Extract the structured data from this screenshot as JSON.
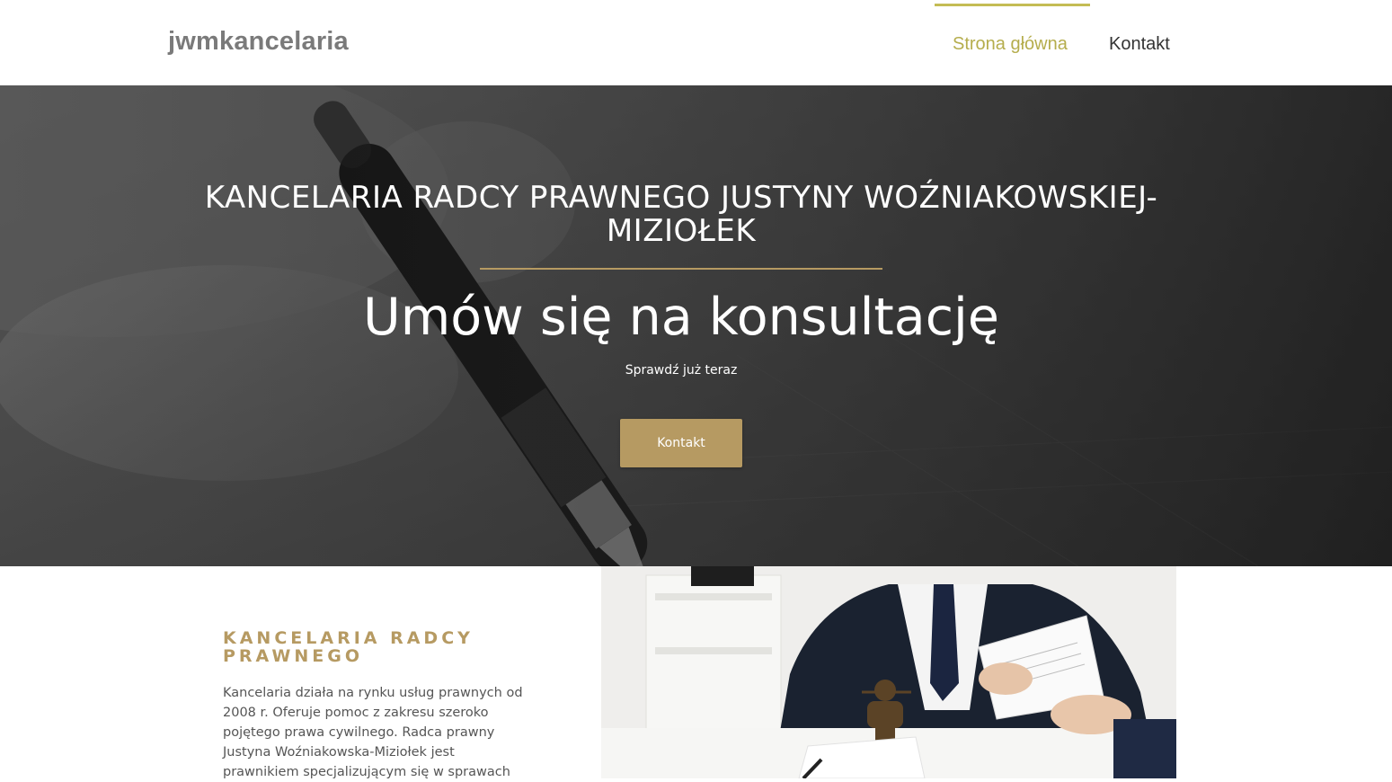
{
  "header": {
    "logo": "jwmkancelaria",
    "nav": [
      {
        "label": "Strona główna",
        "active": true
      },
      {
        "label": "Kontakt",
        "active": false
      }
    ]
  },
  "hero": {
    "title": "KANCELARIA RADCY PRAWNEGO JUSTYNY WOŹNIAKOWSKIEJ-MIZIOŁEK",
    "subtitle": "Umów się na konsultację",
    "tagline": "Sprawdź już teraz",
    "button_label": "Kontakt"
  },
  "about": {
    "heading": "KANCELARIA RADCY PRAWNEGO",
    "text": "Kancelaria działa na rynku usług prawnych od 2008 r. Oferuje pomoc z zakresu szeroko pojętego prawa cywilnego. Radca prawny Justyna Woźniakowska-Miziołek jest prawnikiem specjalizującym się w sprawach"
  },
  "colors": {
    "accent_gold": "#b69a62",
    "nav_active": "#b5ad4d",
    "text_dark": "#333333"
  }
}
